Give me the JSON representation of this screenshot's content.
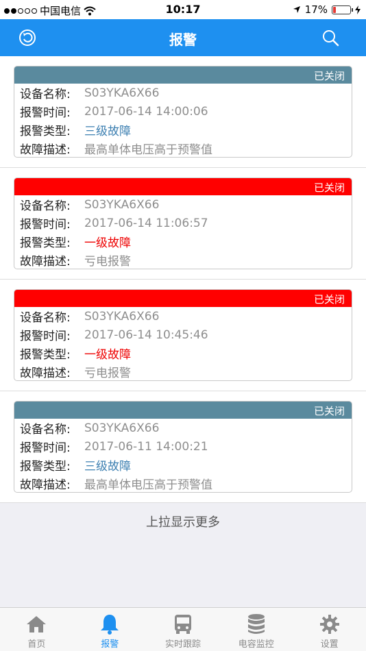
{
  "status": {
    "carrier": "中国电信",
    "time": "10:17",
    "battery": "17%",
    "battery_level": 0.17
  },
  "header": {
    "title": "报警",
    "refresh_icon": "refresh-icon",
    "search_icon": "search-icon"
  },
  "colors": {
    "nav_blue": "#1e90f0",
    "closed_head": "#5a8a9e",
    "alarm_red": "#ff0000",
    "level3_text": "#3c7fb1",
    "level1_text": "#ee0000"
  },
  "alarms": [
    {
      "status": "已关闭",
      "head_color": "#5a8a9e",
      "level_class": "level3",
      "name_key": "设备名称:",
      "name": "S03YKA6X66",
      "time_key": "报警时间:",
      "time": "2017-06-14 14:00:06",
      "type_key": "报警类型:",
      "type": "三级故障",
      "desc_key": "故障描述:",
      "desc": "最高单体电压高于预警值"
    },
    {
      "status": "已关闭",
      "head_color": "#ff0000",
      "level_class": "level1",
      "name_key": "设备名称:",
      "name": "S03YKA6X66",
      "time_key": "报警时间:",
      "time": "2017-06-14 11:06:57",
      "type_key": "报警类型:",
      "type": "一级故障",
      "desc_key": "故障描述:",
      "desc": "亏电报警"
    },
    {
      "status": "已关闭",
      "head_color": "#ff0000",
      "level_class": "level1",
      "name_key": "设备名称:",
      "name": "S03YKA6X66",
      "time_key": "报警时间:",
      "time": "2017-06-14 10:45:46",
      "type_key": "报警类型:",
      "type": "一级故障",
      "desc_key": "故障描述:",
      "desc": "亏电报警"
    },
    {
      "status": "已关闭",
      "head_color": "#5a8a9e",
      "level_class": "level3",
      "name_key": "设备名称:",
      "name": "S03YKA6X66",
      "time_key": "报警时间:",
      "time": "2017-06-11 14:00:21",
      "type_key": "报警类型:",
      "type": "三级故障",
      "desc_key": "故障描述:",
      "desc": "最高单体电压高于预警值"
    }
  ],
  "load_more": "上拉显示更多",
  "tabs": [
    {
      "label": "首页",
      "icon": "home-icon",
      "active": false
    },
    {
      "label": "报警",
      "icon": "bell-icon",
      "active": true
    },
    {
      "label": "实时跟踪",
      "icon": "bus-icon",
      "active": false
    },
    {
      "label": "电容监控",
      "icon": "database-icon",
      "active": false
    },
    {
      "label": "设置",
      "icon": "gear-icon",
      "active": false
    }
  ]
}
